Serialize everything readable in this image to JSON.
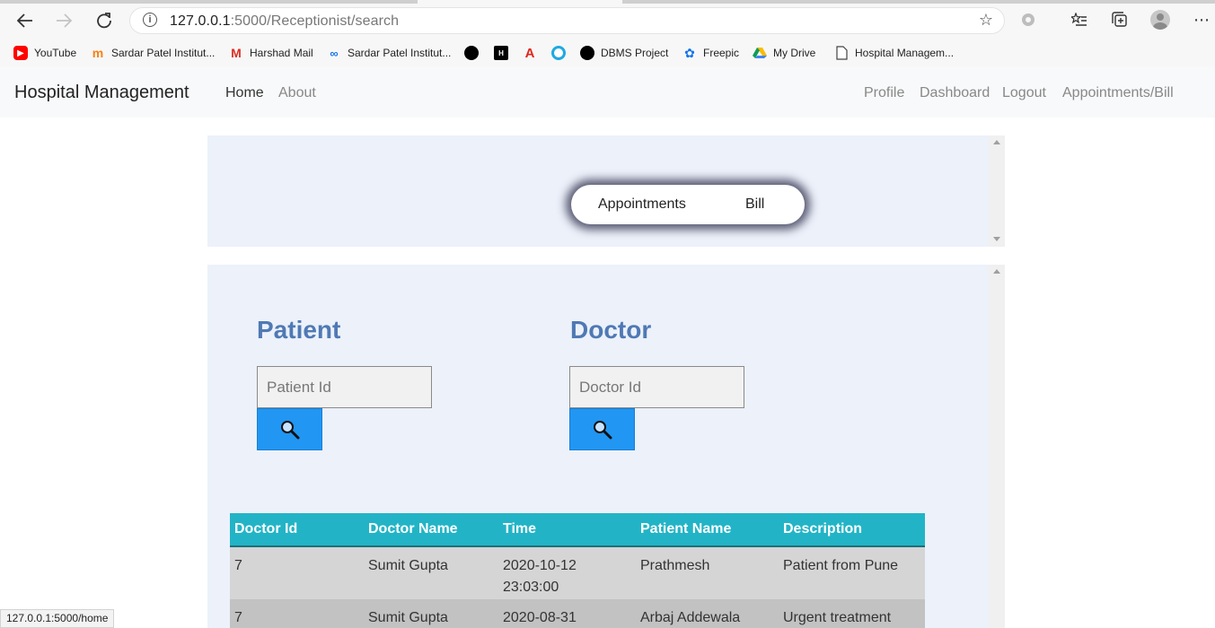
{
  "browser": {
    "url_host": "127.0.0.1",
    "url_rest": ":5000/Receptionist/search",
    "status_url": "127.0.0.1:5000/home"
  },
  "bookmarks": [
    {
      "label": "YouTube",
      "icon": "youtube-icon",
      "color": "#ff0000"
    },
    {
      "label": "Sardar Patel Institut...",
      "icon": "moodle-icon",
      "color": "#f98012"
    },
    {
      "label": "Harshad Mail",
      "icon": "gmail-icon",
      "color": "#d93025"
    },
    {
      "label": "Sardar Patel Institut...",
      "icon": "link-icon",
      "color": "#1a73e8"
    },
    {
      "label": "",
      "icon": "github-icon",
      "color": "#000000"
    },
    {
      "label": "",
      "icon": "hackerrank-icon",
      "color": "#000000"
    },
    {
      "label": "",
      "icon": "adobe-icon",
      "color": "#e1251b"
    },
    {
      "label": "",
      "icon": "circle-app-icon",
      "color": "#1fa9e1"
    },
    {
      "label": "DBMS Project",
      "icon": "github-icon",
      "color": "#000000"
    },
    {
      "label": "Freepic",
      "icon": "freepik-icon",
      "color": "#1273eb"
    },
    {
      "label": "My Drive",
      "icon": "drive-icon",
      "color": "#0f9d58"
    },
    {
      "label": "Hospital Managem...",
      "icon": "page-icon",
      "color": "#555555"
    }
  ],
  "navbar": {
    "brand": "Hospital Management",
    "left_links": [
      "Home",
      "About"
    ],
    "right_links": [
      "Profile",
      "Dashboard",
      "Logout",
      "Appointments/Bill"
    ]
  },
  "tabs": {
    "appointments": "Appointments",
    "bill": "Bill"
  },
  "search": {
    "patient_title": "Patient",
    "patient_placeholder": "Patient Id",
    "doctor_title": "Doctor",
    "doctor_placeholder": "Doctor Id"
  },
  "table": {
    "headers": [
      "Doctor Id",
      "Doctor Name",
      "Time",
      "Patient Name",
      "Description"
    ],
    "rows": [
      [
        "7",
        "Sumit Gupta",
        "2020-10-12 23:03:00",
        "Prathmesh",
        "Patient from Pune"
      ],
      [
        "7",
        "Sumit Gupta",
        "2020-08-31",
        "Arbaj Addewala",
        "Urgent treatment"
      ]
    ]
  },
  "colors": {
    "accent": "#2196f3",
    "table_header": "#22b4c6",
    "section_title": "#4f79b4",
    "panel_bg": "#ecf1fa"
  }
}
